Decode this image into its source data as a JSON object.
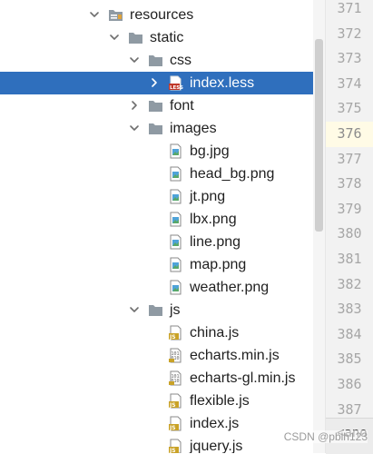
{
  "tree": {
    "rows": [
      {
        "label": "resources",
        "type": "folder",
        "depth": 0,
        "expanded": true
      },
      {
        "label": "static",
        "type": "folder",
        "depth": 1,
        "expanded": true
      },
      {
        "label": "css",
        "type": "folder",
        "depth": 2,
        "expanded": true
      },
      {
        "label": "index.less",
        "type": "less",
        "depth": 3,
        "expanded": false,
        "selected": true
      },
      {
        "label": "font",
        "type": "folder",
        "depth": 2,
        "expanded": false
      },
      {
        "label": "images",
        "type": "folder",
        "depth": 2,
        "expanded": true
      },
      {
        "label": "bg.jpg",
        "type": "image",
        "depth": 3
      },
      {
        "label": "head_bg.png",
        "type": "image",
        "depth": 3
      },
      {
        "label": "jt.png",
        "type": "image",
        "depth": 3
      },
      {
        "label": "lbx.png",
        "type": "image",
        "depth": 3
      },
      {
        "label": "line.png",
        "type": "image",
        "depth": 3
      },
      {
        "label": "map.png",
        "type": "image",
        "depth": 3
      },
      {
        "label": "weather.png",
        "type": "image",
        "depth": 3
      },
      {
        "label": "js",
        "type": "folder",
        "depth": 2,
        "expanded": true
      },
      {
        "label": "china.js",
        "type": "js",
        "depth": 3
      },
      {
        "label": "echarts.min.js",
        "type": "binary",
        "depth": 3
      },
      {
        "label": "echarts-gl.min.js",
        "type": "binary",
        "depth": 3
      },
      {
        "label": "flexible.js",
        "type": "js",
        "depth": 3
      },
      {
        "label": "index.js",
        "type": "js",
        "depth": 3
      },
      {
        "label": "jquery.js",
        "type": "js",
        "depth": 3
      }
    ]
  },
  "gutter": {
    "line_numbers": [
      "371",
      "372",
      "373",
      "374",
      "375",
      "376",
      "377",
      "378",
      "379",
      "380",
      "381",
      "382",
      "383",
      "384",
      "385",
      "386",
      "387"
    ],
    "current_line": "376"
  },
  "editor_bar": {
    "text": "<ano"
  },
  "watermark": "CSDN @pblh123",
  "colors": {
    "selection": "#2f6fbd",
    "folder": "#8f9aa3",
    "js_badge": "#c9a227",
    "less_badge": "#c0392b"
  }
}
